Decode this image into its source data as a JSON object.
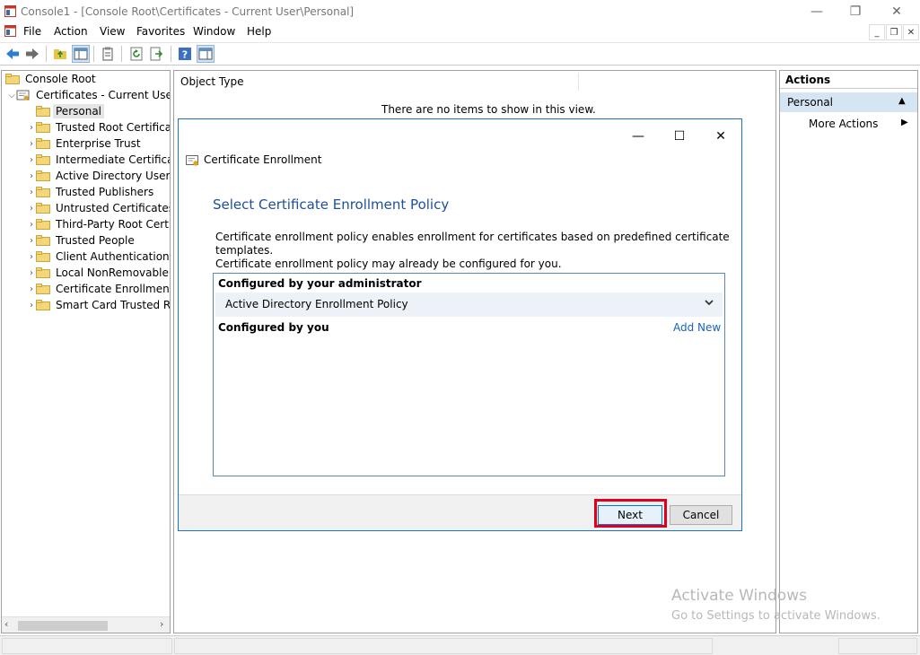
{
  "window": {
    "title": "Console1 - [Console Root\\Certificates - Current User\\Personal]",
    "controls": {
      "minimize": "—",
      "restore": "❐",
      "close": "✕"
    }
  },
  "menu": {
    "items": [
      "File",
      "Action",
      "View",
      "Favorites",
      "Window",
      "Help"
    ],
    "mdi_controls": {
      "minimize": "_",
      "restore": "❐",
      "close": "✕"
    }
  },
  "toolbar": {
    "buttons": [
      "back-icon",
      "forward-icon",
      "up-folder-icon",
      "show-hide-tree-icon",
      "properties-icon",
      "refresh-icon",
      "export-list-icon",
      "help-icon",
      "show-action-pane-icon"
    ]
  },
  "tree": {
    "root": "Console Root",
    "store": "Certificates - Current User",
    "items": [
      "Personal",
      "Trusted Root Certificatio",
      "Enterprise Trust",
      "Intermediate Certificatio",
      "Active Directory User Ol",
      "Trusted Publishers",
      "Untrusted Certificates",
      "Third-Party Root Certifi",
      "Trusted People",
      "Client Authentication Is",
      "Local NonRemovable C",
      "Certificate Enrollment R",
      "Smart Card Trusted Roo"
    ],
    "selected": "Personal"
  },
  "center": {
    "column_header": "Object Type",
    "empty_message": "There are no items to show in this view."
  },
  "actions": {
    "title": "Actions",
    "group": "Personal",
    "more": "More Actions"
  },
  "dialog": {
    "controls": {
      "minimize": "—",
      "maximize": "☐",
      "close": "✕"
    },
    "title": "Certificate Enrollment",
    "heading": "Select Certificate Enrollment Policy",
    "description_line1": "Certificate enrollment policy enables enrollment for certificates based on predefined certificate templates.",
    "description_line2": "Certificate enrollment policy may already be configured for you.",
    "configured_by_admin": "Configured by your administrator",
    "policy": "Active Directory Enrollment Policy",
    "configured_by_you": "Configured by you",
    "add_new": "Add New",
    "next": "Next",
    "cancel": "Cancel"
  },
  "watermark": {
    "line1": "Activate Windows",
    "line2": "Go to Settings to activate Windows."
  },
  "colors": {
    "accent": "#0078d7",
    "heading_blue": "#1e4f9c",
    "highlight_red": "#e0001b",
    "folder_yellow": "#f3d57a"
  }
}
